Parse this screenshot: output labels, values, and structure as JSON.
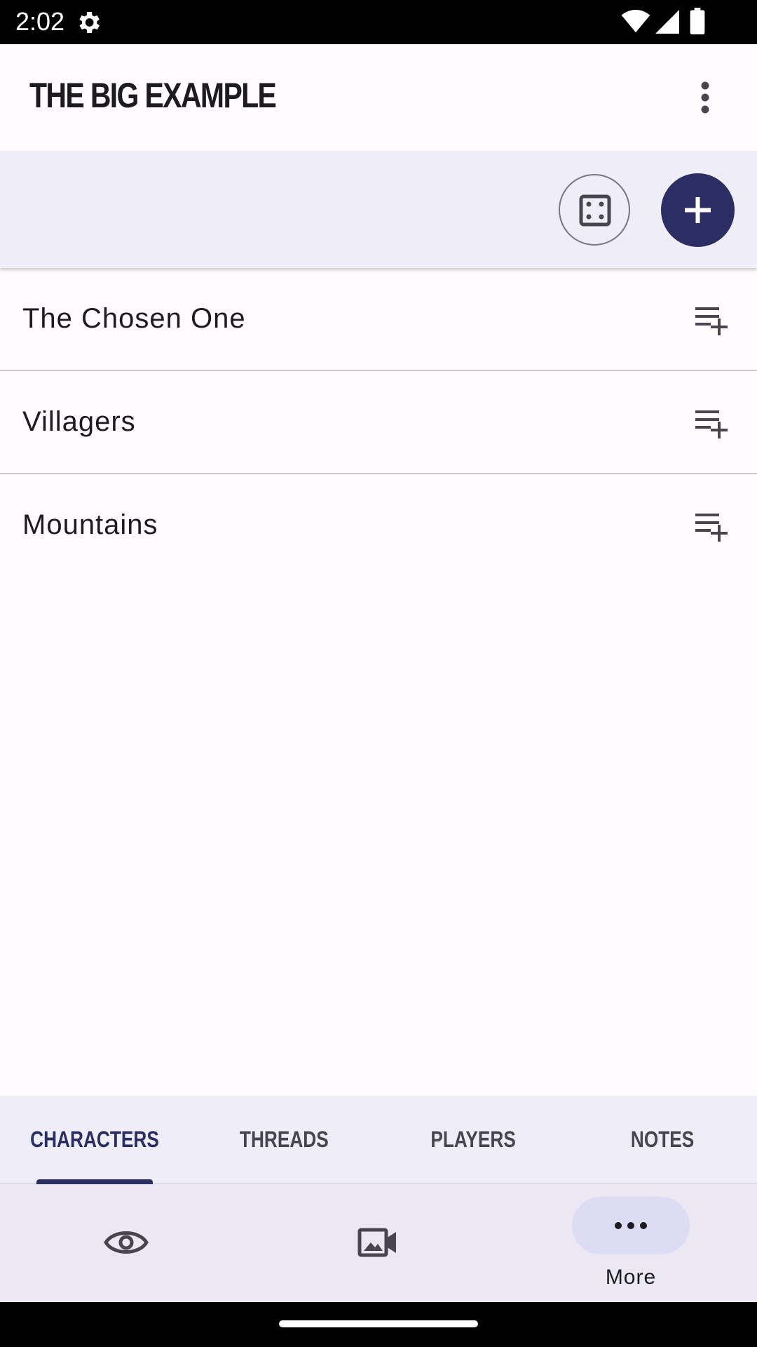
{
  "status_bar": {
    "time": "2:02",
    "icons": [
      "settings-gear-icon",
      "wifi-icon",
      "signal-icon",
      "battery-icon"
    ]
  },
  "app_bar": {
    "title": "THE BIG EXAMPLE",
    "overflow_icon": "more-vert-icon"
  },
  "actions": {
    "dice_icon": "dice-icon",
    "add_icon": "plus-icon"
  },
  "list": {
    "items": [
      {
        "label": "The Chosen One",
        "icon": "playlist-add-icon"
      },
      {
        "label": "Villagers",
        "icon": "playlist-add-icon"
      },
      {
        "label": "Mountains",
        "icon": "playlist-add-icon"
      }
    ]
  },
  "tabs": [
    {
      "label": "CHARACTERS",
      "active": true
    },
    {
      "label": "THREADS",
      "active": false
    },
    {
      "label": "PLAYERS",
      "active": false
    },
    {
      "label": "NOTES",
      "active": false
    }
  ],
  "bottom_nav": {
    "items": [
      {
        "icon": "eye-icon",
        "label": ""
      },
      {
        "icon": "video-scene-icon",
        "label": ""
      },
      {
        "icon": "more-horiz-icon",
        "label": "More",
        "selected": true
      }
    ]
  },
  "colors": {
    "primary": "#2c2d63",
    "background": "#fffbfe",
    "surface": "#efedf7",
    "divider": "#cac7ce"
  }
}
